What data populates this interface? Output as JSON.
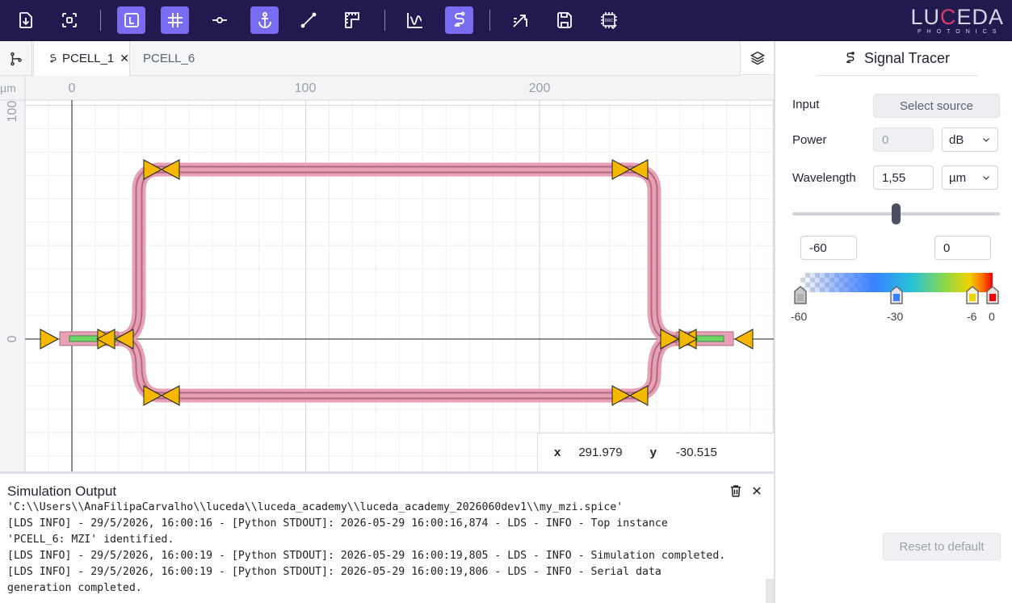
{
  "app": {
    "logo_text": "LUCEDA",
    "logo_sub": "PHOTONICS"
  },
  "toolbar": {
    "buttons": [
      {
        "name": "import-icon",
        "active": false
      },
      {
        "name": "fit-view-icon",
        "active": false
      },
      {
        "name": "layer-l-icon",
        "active": true
      },
      {
        "name": "grid-icon",
        "active": true
      },
      {
        "name": "port-icon",
        "active": false
      },
      {
        "name": "anchor-icon",
        "active": true
      },
      {
        "name": "measure-line-icon",
        "active": false
      },
      {
        "name": "ruler-icon",
        "active": false
      },
      {
        "name": "plot-icon",
        "active": false
      },
      {
        "name": "signal-trace-icon",
        "active": true
      },
      {
        "name": "route-icon",
        "active": false
      },
      {
        "name": "save-icon",
        "active": false
      },
      {
        "name": "drc-icon",
        "active": false
      }
    ],
    "accent_color": "#7a6cf0",
    "bar_color": "#221a4f"
  },
  "tabs": [
    {
      "label": "PCELL_1",
      "active": true,
      "closable": true
    },
    {
      "label": "PCELL_6",
      "active": false,
      "closable": false
    }
  ],
  "canvas": {
    "unit": "µm",
    "x_ticks": [
      "0",
      "100",
      "200"
    ],
    "y_ticks": [
      "100",
      "0"
    ],
    "waveguide_color": "#e8a0b4",
    "core_color": "#6fd66a",
    "port_color": "#f5b800"
  },
  "coords": {
    "x_label": "x",
    "x_value": "291.979",
    "y_label": "y",
    "y_value": "-30.515"
  },
  "simulation": {
    "title": "Simulation Output",
    "log": "'C:\\\\Users\\\\AnaFilipaCarvalho\\\\luceda\\\\luceda_academy\\\\luceda_academy_2026060dev1\\\\my_mzi.spice'\n[LDS INFO] - 29/5/2026, 16:00:16 - [Python STDOUT]: 2026-05-29 16:00:16,874 - LDS - INFO - Top instance\n'PCELL_6: MZI' identified.\n[LDS INFO] - 29/5/2026, 16:00:19 - [Python STDOUT]: 2026-05-29 16:00:19,805 - LDS - INFO - Simulation completed.\n[LDS INFO] - 29/5/2026, 16:00:19 - [Python STDOUT]: 2026-05-29 16:00:19,806 - LDS - INFO - Serial data\ngeneration completed."
  },
  "signal_tracer": {
    "title": "Signal Tracer",
    "input_label": "Input",
    "input_button": "Select source",
    "power_label": "Power",
    "power_value": "0",
    "power_unit": "dB",
    "wavelength_label": "Wavelength",
    "wavelength_value": "1,55",
    "wavelength_unit": "µm",
    "slider_position": 0.5,
    "range_min": "-60",
    "range_max": "0",
    "scale_stops": [
      {
        "label": "-60",
        "color": "#c8c8c8"
      },
      {
        "label": "-30",
        "color": "#3a80ff"
      },
      {
        "label": "-6",
        "color": "#f0d200"
      },
      {
        "label": "0",
        "color": "#f00000"
      }
    ],
    "reset_label": "Reset to default"
  }
}
